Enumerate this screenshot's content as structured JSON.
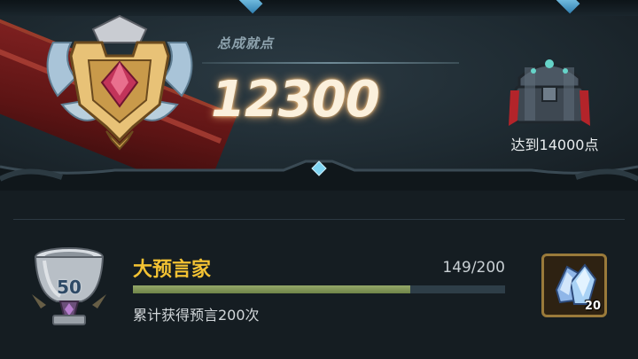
{
  "header": {
    "score_label": "总成就点",
    "score_value": "12300",
    "next_reward_label": "达到14000点"
  },
  "achievement": {
    "trophy_level": "50",
    "title": "大预言家",
    "progress_text": "149/200",
    "progress_fraction": 0.745,
    "description": "累计获得预言200次",
    "reward_count": "20",
    "reward_icon": "crystal-icon"
  },
  "colors": {
    "title_gold": "#f3c233",
    "progress_fill": "#8a9d5c",
    "background": "#151d22"
  }
}
